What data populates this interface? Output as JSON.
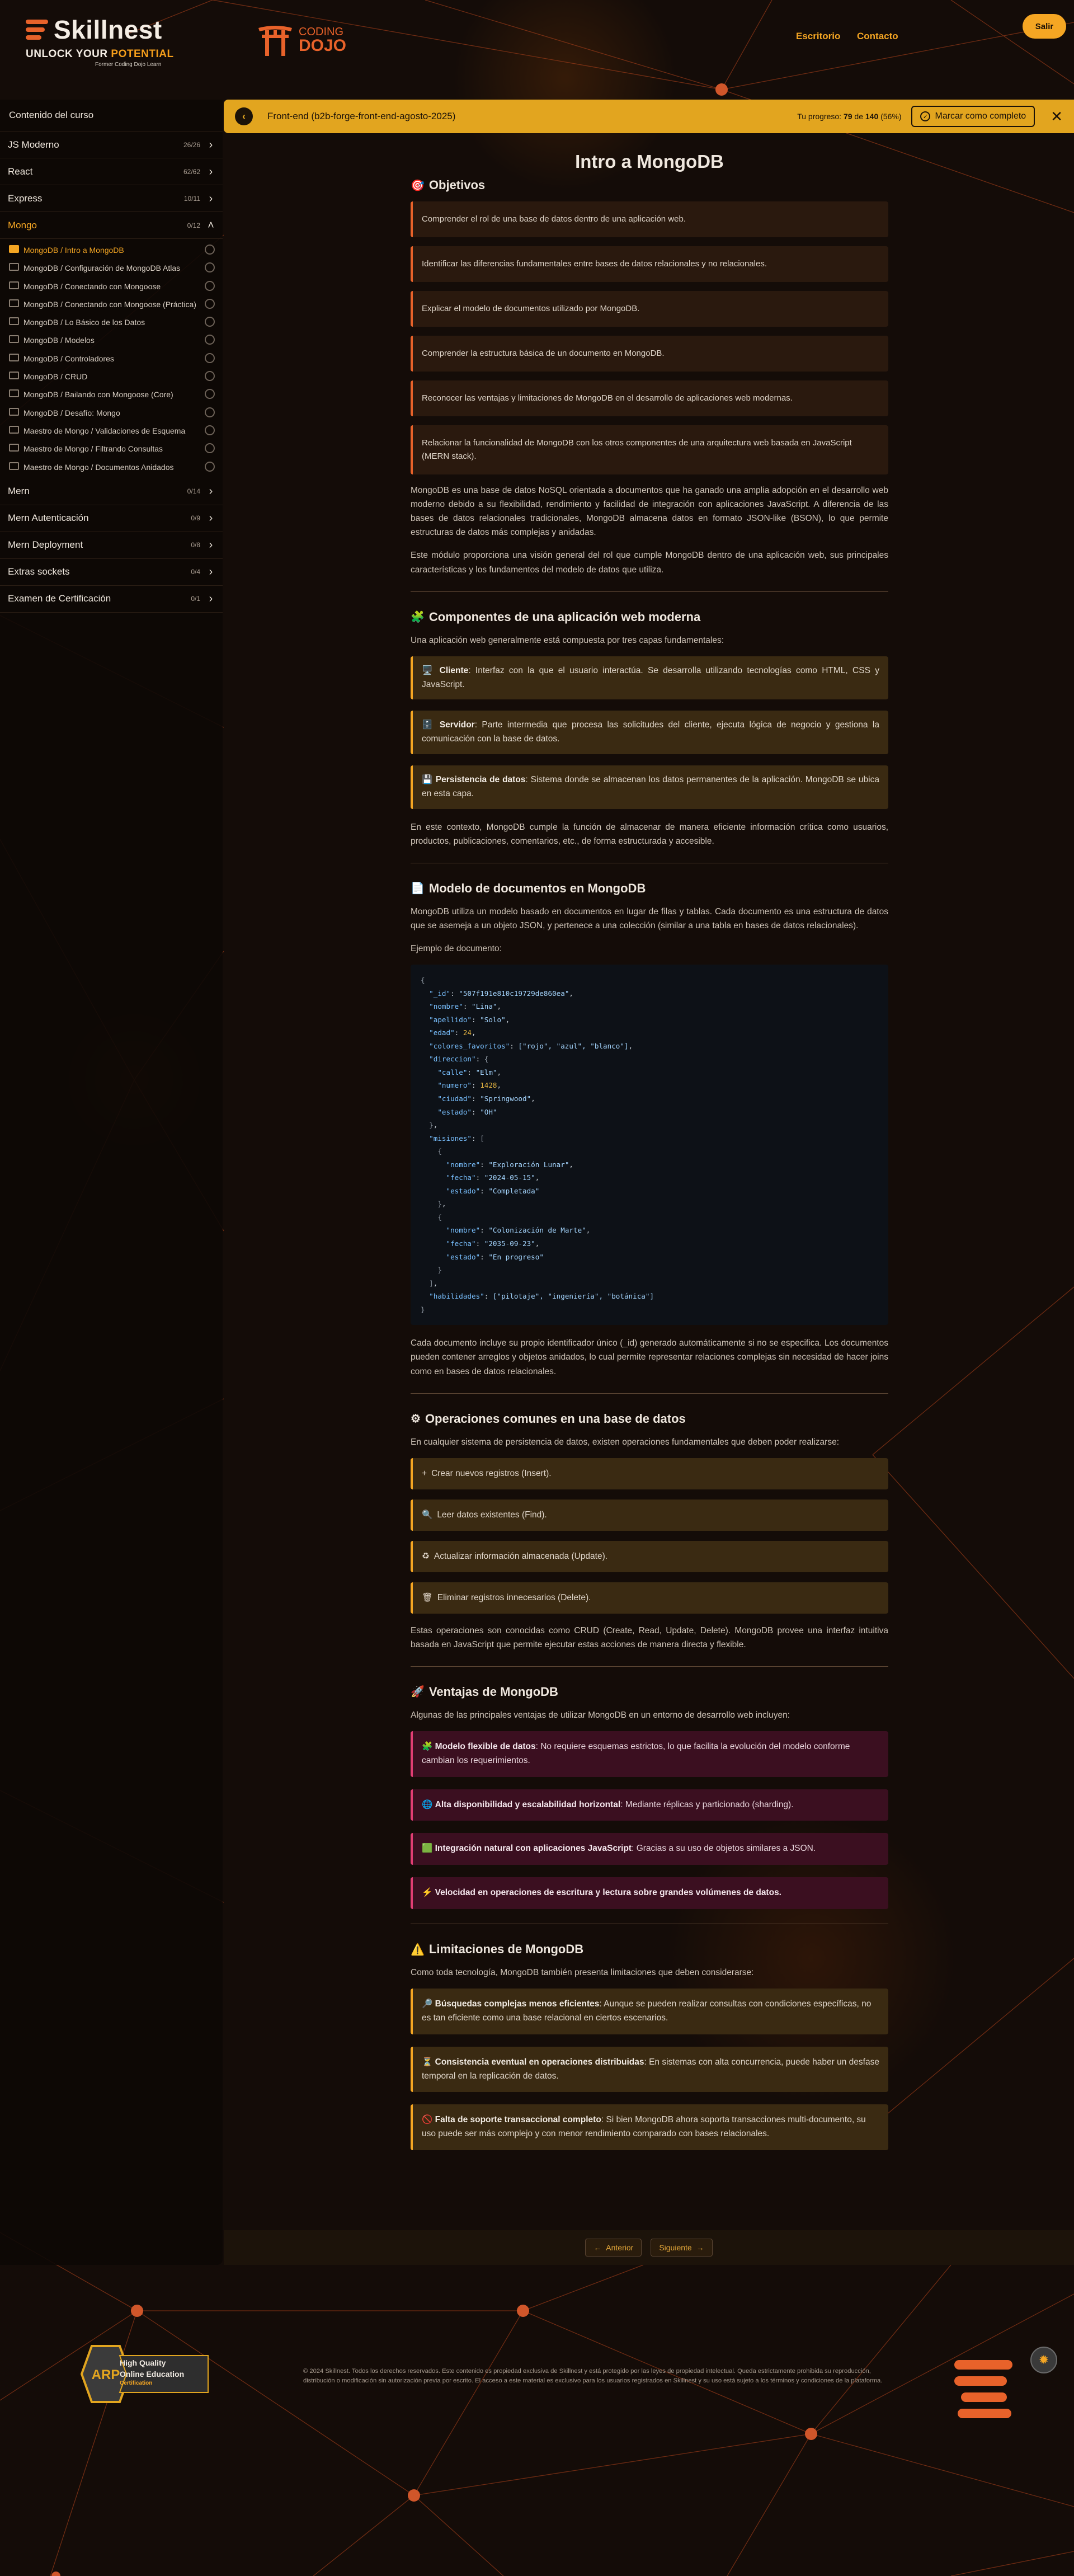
{
  "header": {
    "brand_name": "Skillnest",
    "tagline_pre": "UNLOCK YOUR ",
    "tagline_hl": "POTENTIAL",
    "brand_sub": "Former Coding Dojo Learn",
    "dojo_line1": "CODING",
    "dojo_line2": "DOJO",
    "nav_desktop": "Escritorio",
    "nav_contact": "Contacto",
    "logout": "Salir"
  },
  "sidebar": {
    "heading": "Contenido del curso",
    "modules_before": [
      {
        "name": "JS Moderno",
        "count": "26/26"
      },
      {
        "name": "React",
        "count": "62/62"
      },
      {
        "name": "Express",
        "count": "10/11"
      }
    ],
    "open_module": {
      "name": "Mongo",
      "count": "0/12"
    },
    "lessons": [
      "MongoDB / Intro a MongoDB",
      "MongoDB / Configuración de MongoDB Atlas",
      "MongoDB / Conectando con Mongoose",
      "MongoDB / Conectando con Mongoose (Práctica)",
      "MongoDB / Lo Básico de los Datos",
      "MongoDB / Modelos",
      "MongoDB / Controladores",
      "MongoDB / CRUD",
      "MongoDB / Bailando con Mongoose (Core)",
      "MongoDB / Desafío: Mongo",
      "Maestro de Mongo / Validaciones de Esquema",
      "Maestro de Mongo / Filtrando Consultas",
      "Maestro de Mongo / Documentos Anidados"
    ],
    "modules_after": [
      {
        "name": "Mern",
        "count": "0/14"
      },
      {
        "name": "Mern Autenticación",
        "count": "0/9"
      },
      {
        "name": "Mern Deployment",
        "count": "0/8"
      },
      {
        "name": "Extras sockets",
        "count": "0/4"
      },
      {
        "name": "Examen de Certificación",
        "count": "0/1"
      }
    ]
  },
  "progressbar": {
    "course": "Front-end (b2b-forge-front-end-agosto-2025)",
    "prefix": "Tu progreso: ",
    "done": "79",
    "of": " de ",
    "total": "140",
    "pct": " (56%)",
    "percent_value": 56,
    "complete_label": "Marcar como completo",
    "close": "✕"
  },
  "main": {
    "title": "Intro a MongoDB",
    "objectives_title": "Objetivos",
    "objectives": [
      "Comprender el rol de una base de datos dentro de una aplicación web.",
      "Identificar las diferencias fundamentales entre bases de datos relacionales y no relacionales.",
      "Explicar el modelo de documentos utilizado por MongoDB.",
      "Comprender la estructura básica de un documento en MongoDB.",
      "Reconocer las ventajas y limitaciones de MongoDB en el desarrollo de aplicaciones web modernas.",
      "Relacionar la funcionalidad de MongoDB con los otros componentes de una arquitectura web basada en JavaScript (MERN stack)."
    ],
    "intro_p1": "MongoDB es una base de datos NoSQL orientada a documentos que ha ganado una amplia adopción en el desarrollo web moderno debido a su flexibilidad, rendimiento y facilidad de integración con aplicaciones JavaScript. A diferencia de las bases de datos relacionales tradicionales, MongoDB almacena datos en formato JSON-like (BSON), lo que permite estructuras de datos más complejas y anidadas.",
    "intro_p2": "Este módulo proporciona una visión general del rol que cumple MongoDB dentro de una aplicación web, sus principales características y los fundamentos del modelo de datos que utiliza.",
    "components_title": "Componentes de una aplicación web moderna",
    "components_intro": "Una aplicación web generalmente está compuesta por tres capas fundamentales:",
    "layers": [
      {
        "icon": "🖥️",
        "name": "Cliente",
        "text": ": Interfaz con la que el usuario interactúa. Se desarrolla utilizando tecnologías como HTML, CSS y JavaScript."
      },
      {
        "icon": "🗄️",
        "name": "Servidor",
        "text": ": Parte intermedia que procesa las solicitudes del cliente, ejecuta lógica de negocio y gestiona la comunicación con la base de datos."
      },
      {
        "icon": "💾",
        "name": "Persistencia de datos",
        "text": ": Sistema donde se almacenan los datos permanentes de la aplicación. MongoDB se ubica en esta capa."
      }
    ],
    "components_outro": "En este contexto, MongoDB cumple la función de almacenar de manera eficiente información crítica como usuarios, productos, publicaciones, comentarios, etc., de forma estructurada y accesible.",
    "model_title": "Modelo de documentos en MongoDB",
    "model_p1": "MongoDB utiliza un modelo basado en documentos en lugar de filas y tablas. Cada documento es una estructura de datos que se asemeja a un objeto JSON, y pertenece a una colección (similar a una tabla en bases de datos relacionales).",
    "model_example": "Ejemplo de documento:",
    "model_p2": "Cada documento incluye su propio identificador único (_id) generado automáticamente si no se especifica. Los documentos pueden contener arreglos y objetos anidados, lo cual permite representar relaciones complejas sin necesidad de hacer joins como en bases de datos relacionales.",
    "ops_title": "Operaciones comunes en una base de datos",
    "ops_intro": "En cualquier sistema de persistencia de datos, existen operaciones fundamentales que deben poder realizarse:",
    "ops": [
      {
        "icon": "+",
        "text": "Crear nuevos registros (Insert)."
      },
      {
        "icon": "🔍",
        "text": "Leer datos existentes (Find)."
      },
      {
        "icon": "♻",
        "text": "Actualizar información almacenada (Update)."
      },
      {
        "icon": "🗑",
        "text": "Eliminar registros innecesarios (Delete)."
      }
    ],
    "ops_outro": "Estas operaciones son conocidas como CRUD (Create, Read, Update, Delete). MongoDB provee una interfaz intuitiva basada en JavaScript que permite ejecutar estas acciones de manera directa y flexible.",
    "adv_title": "Ventajas de MongoDB",
    "adv_intro": "Algunas de las principales ventajas de utilizar MongoDB en un entorno de desarrollo web incluyen:",
    "advantages": [
      {
        "icon": "🧩",
        "name": "Modelo flexible de datos",
        "text": ": No requiere esquemas estrictos, lo que facilita la evolución del modelo conforme cambian los requerimientos."
      },
      {
        "icon": "🌐",
        "name": "Alta disponibilidad y escalabilidad horizontal",
        "text": ": Mediante réplicas y particionado (sharding)."
      },
      {
        "icon": "🟩",
        "name": "Integración natural con aplicaciones JavaScript",
        "text": ": Gracias a su uso de objetos similares a JSON."
      },
      {
        "icon": "⚡",
        "name": "Velocidad en operaciones de escritura y lectura sobre grandes volúmenes de datos.",
        "text": ""
      }
    ],
    "lim_title": "Limitaciones de MongoDB",
    "lim_intro": "Como toda tecnología, MongoDB también presenta limitaciones que deben considerarse:",
    "limitations": [
      {
        "icon": "🔎",
        "name": "Búsquedas complejas menos eficientes",
        "text": ": Aunque se pueden realizar consultas con condiciones específicas, no es tan eficiente como una base relacional en ciertos escenarios."
      },
      {
        "icon": "⏳",
        "name": "Consistencia eventual en operaciones distribuidas",
        "text": ": En sistemas con alta concurrencia, puede haber un desfase temporal en la replicación de datos."
      },
      {
        "icon": "🚫",
        "name": "Falta de soporte transaccional completo",
        "text": ": Si bien MongoDB ahora soporta transacciones multi-documento, su uso puede ser más complejo y con menor rendimiento comparado con bases relacionales."
      }
    ]
  },
  "code": {
    "id": "\"507f191e810c19729de860ea\"",
    "nombre": "\"Lina\"",
    "apellido": "\"Solo\"",
    "edad": "24",
    "colores_fav": "[\"rojo\", \"azul\", \"blanco\"]",
    "calle": "\"Elm\"",
    "numero": "1428",
    "ciudad": "\"Springwood\"",
    "estado": "\"OH\"",
    "m1_nombre": "\"Exploración Lunar\"",
    "m1_fecha": "\"2024-05-15\"",
    "m1_estado": "\"Completada\"",
    "m2_nombre": "\"Colonización de Marte\"",
    "m2_fecha": "\"2035-09-23\"",
    "m2_estado": "\"En progreso\"",
    "habilidades": "[\"pilotaje\", \"ingeniería\", \"botánica\"]"
  },
  "pager": {
    "prev": "Anterior",
    "next": "Siguiente"
  },
  "footer": {
    "badge_acronym": "ARP",
    "badge_line1": "High Quality",
    "badge_line2": "Online Education",
    "badge_line3": "Certification",
    "copyright": "© 2024 Skillnest. Todos los derechos reservados. Este contenido es propiedad exclusiva de Skillnest y está protegido por las leyes de propiedad intelectual. Queda estrictamente prohibida su reproducción, distribución o modificación sin autorización previa por escrito. El acceso a este material es exclusivo para los usuarios registrados en Skillnest y su uso está sujeto a los términos y condiciones de la plataforma."
  },
  "colors": {
    "accent_orange": "#e8622a",
    "accent_gold": "#f5a623",
    "background": "#140c08",
    "advantage_pink": "#e23e74"
  }
}
